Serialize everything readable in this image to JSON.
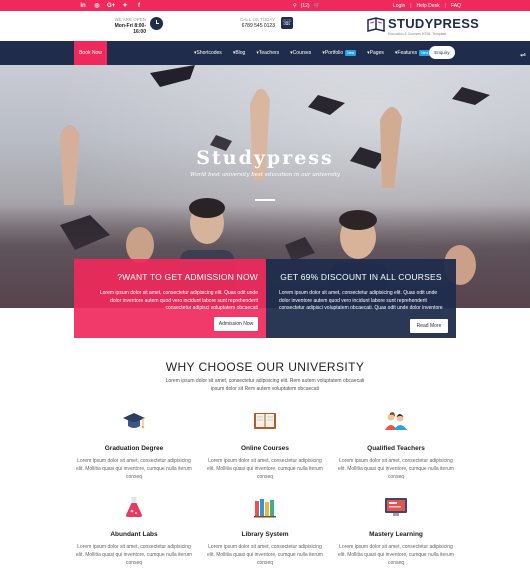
{
  "topbar": {
    "social_icons": [
      {
        "name": "linkedin-icon",
        "glyph": "in"
      },
      {
        "name": "dribbble-icon",
        "glyph": "◎"
      },
      {
        "name": "google-plus-icon",
        "glyph": "G+"
      },
      {
        "name": "twitter-icon",
        "glyph": "✦"
      },
      {
        "name": "facebook-icon",
        "glyph": "f"
      }
    ],
    "search_glyph": "⚲",
    "cart_text": "(12)",
    "cart_glyph": "🛒",
    "login": "Login",
    "help_desk": "Help Desk",
    "faq": "FAQ"
  },
  "header": {
    "hours_label": "WE ARE OPEN",
    "hours_value": "Mon-Fri 8:00-16:00",
    "call_label": "CALL US TODAY",
    "call_value": "6789 545 0123",
    "logo_name": "STUDYPRESS",
    "logo_tagline": "Education & Courses HTML Template"
  },
  "nav": {
    "book_now": "Book Now",
    "items": [
      {
        "label": "Shortcodes",
        "new": ""
      },
      {
        "label": "Blog",
        "new": ""
      },
      {
        "label": "Teachers",
        "new": ""
      },
      {
        "label": "Courses",
        "new": ""
      },
      {
        "label": "Portfolio",
        "new": "New"
      },
      {
        "label": "Pages",
        "new": ""
      },
      {
        "label": "Features",
        "new": "New"
      }
    ],
    "enquiry": "Enquiry",
    "side_tab_glyph": "⇌"
  },
  "hero": {
    "title": "Studypress",
    "subtitle": "World best university best education in our university"
  },
  "promos": {
    "admission": {
      "title": "?WANT TO GET ADMISSION NOW",
      "text": "Lorem ipsum dolor sit amet, consectetur adipisicing elit. Quas odit unde dolor inventore autem quod vero incidunt labore sunt reprehenderit consectetur adipisci voluptatem obcaecati",
      "button": "Admission Now"
    },
    "discount": {
      "title": "GET 69% DISCOUNT IN ALL COURSES",
      "text": "Lorem ipsum dolor sit amet, consectetur adipisicing elit. Quas odit unde dolor inventore autem quod vero incidunt labore sunt reprehenderit consectetur adipisci voluptatem obcaecati. Quas odit unde dolor inventore",
      "button": "Read More"
    }
  },
  "why": {
    "title": "WHY CHOOSE OUR UNIVERSITY",
    "subtitle": "Lorem ipsum dolor sit amet, consectetur adipisicing elit. Rem autem voluptatem obcaecati ipsum dolor sit Rem autem voluptatem obcaecati",
    "features": [
      {
        "title": "Graduation Degree",
        "text": "Lorem ipsum dolor sit amet, consectetur adipisicing elit. Mollitia quasi qui inventore, cumque nulla iterum conseq",
        "icon": "graduation-cap-icon"
      },
      {
        "title": "Online Courses",
        "text": "Lorem ipsum dolor sit amet, consectetur adipisicing elit. Mollitia quasi qui inventore, cumque nulla iterum conseq",
        "icon": "open-book-icon"
      },
      {
        "title": "Qualified Teachers",
        "text": "Lorem ipsum dolor sit amet, consectetur adipisicing elit. Mollitia quasi qui inventore, cumque nulla iterum conseq",
        "icon": "teachers-icon"
      },
      {
        "title": "Abundant Labs",
        "text": "Lorem ipsum dolor sit amet, consectetur adipisicing elit. Mollitia quasi qui inventore, cumque nulla iterum conseq",
        "icon": "lab-flask-icon"
      },
      {
        "title": "Library System",
        "text": "Lorem ipsum dolor sit amet, consectetur adipisicing elit. Mollitia quasi qui inventore, cumque nulla iterum conseq",
        "icon": "library-books-icon"
      },
      {
        "title": "Mastery Learning",
        "text": "Lorem ipsum dolor sit amet, consectetur adipisicing elit. Mollitia quasi qui inventore, cumque nulla iterum conseq",
        "icon": "monitor-icon"
      }
    ]
  },
  "colors": {
    "accent": "#f0295c",
    "navy": "#1f2c4c"
  }
}
